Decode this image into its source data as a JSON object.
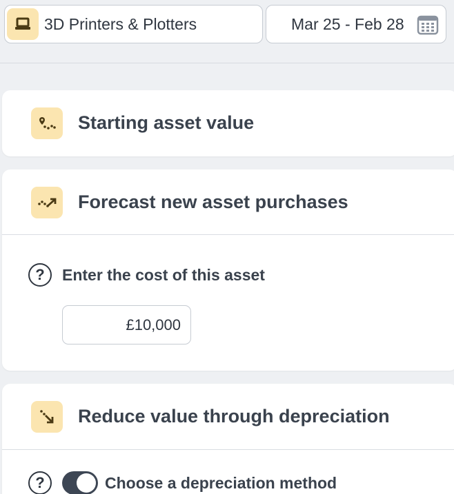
{
  "header": {
    "category_label": "3D Printers & Plotters",
    "category_icon": "laptop-icon",
    "date_range": "Mar 25 - Feb 28",
    "date_icon": "calendar-icon"
  },
  "sections": [
    {
      "title": "Starting asset value",
      "icon": "map-route-icon"
    },
    {
      "title": "Forecast new asset purchases",
      "icon": "trend-up-icon",
      "question": "Enter the cost of this asset",
      "cost_value": "£10,000"
    },
    {
      "title": "Reduce value through depreciation",
      "icon": "arrow-down-right-icon",
      "question": "Choose a depreciation method",
      "toggle_on": true
    }
  ],
  "help_glyph": "?",
  "colors": {
    "accent_bg": "#fbe5b0",
    "accent_icon": "#4a3a14",
    "text": "#2f3640",
    "toggle": "#3d4654"
  }
}
